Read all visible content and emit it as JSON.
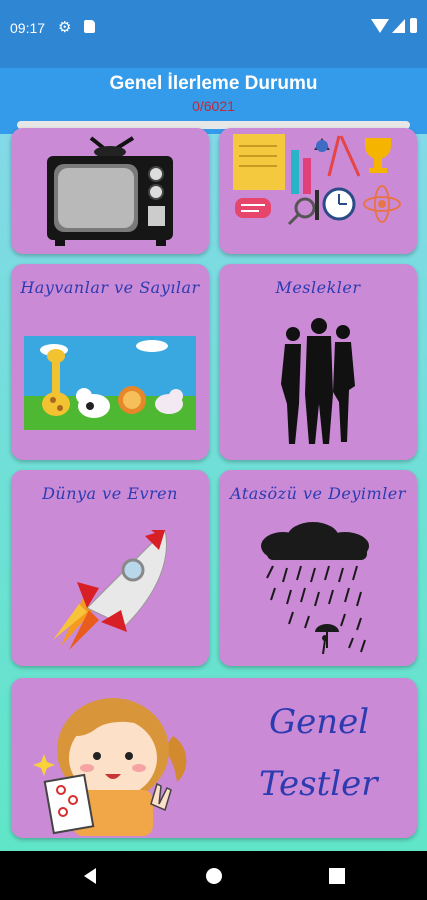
{
  "status_bar": {
    "time": "09:17",
    "icons": [
      "gear-icon",
      "sd-card-icon",
      "wifi-icon",
      "signal-icon",
      "battery-icon"
    ]
  },
  "header": {
    "title": "Genel İlerleme Durumu",
    "progress_text": "0/6021",
    "progress_value": 0,
    "progress_color": "#c02a38"
  },
  "categories": [
    {
      "label": "",
      "icon": "television-icon"
    },
    {
      "label": "",
      "icon": "school-supplies-icon"
    },
    {
      "label": "Hayvanlar ve Sayılar",
      "icon": "animals-icon"
    },
    {
      "label": "Meslekler",
      "icon": "people-silhouette-icon"
    },
    {
      "label": "Dünya ve Evren",
      "icon": "rocket-icon"
    },
    {
      "label": "Atasözü ve Deyimler",
      "icon": "word-rain-cloud-icon"
    }
  ],
  "general_tests": {
    "line1": "Genel",
    "line2": "Testler",
    "icon": "girl-with-test-paper-icon"
  },
  "nav_bar": {
    "icons": [
      "back-icon",
      "home-icon",
      "recents-icon"
    ]
  }
}
